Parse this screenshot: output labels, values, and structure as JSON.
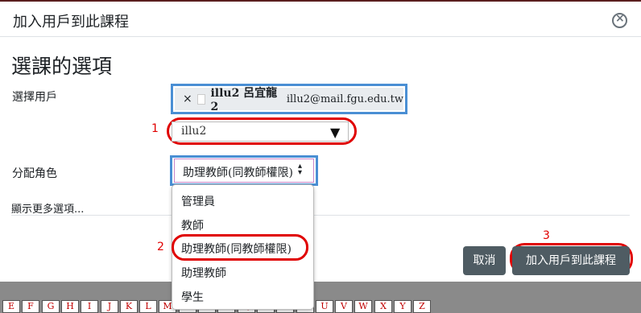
{
  "modal": {
    "title": "加入用戶到此課程",
    "close_glyph": "×"
  },
  "section_heading": "選課的選項",
  "select_users": {
    "label": "選擇用戶",
    "chip": {
      "remove_glyph": "×",
      "name": "illu2 呂宜龍2",
      "email": "illu2@mail.fgu.edu.tw"
    },
    "search_value": "illu2",
    "search_arrow": "▼"
  },
  "assign_role": {
    "label": "分配角色",
    "selected": "助理教師(同教師權限)",
    "caret": "▴▾",
    "options": [
      "管理員",
      "教師",
      "助理教師(同教師權限)",
      "助理教師",
      "學生"
    ]
  },
  "more_options_link": "顯示更多選項...",
  "buttons": {
    "cancel": "取消",
    "add": "加入用戶到此課程"
  },
  "annotations": [
    "1",
    "2",
    "3"
  ],
  "background_letters": [
    "E",
    "F",
    "G",
    "H",
    "I",
    "J",
    "K",
    "L",
    "M",
    "N",
    "O",
    "P",
    "Q",
    "R",
    "S",
    "T",
    "U",
    "V",
    "W",
    "X",
    "Y",
    "Z"
  ],
  "colors": {
    "annotation_red": "#e00000",
    "highlight_blue": "#4a8fd4",
    "button_gray": "#4f5c63"
  }
}
